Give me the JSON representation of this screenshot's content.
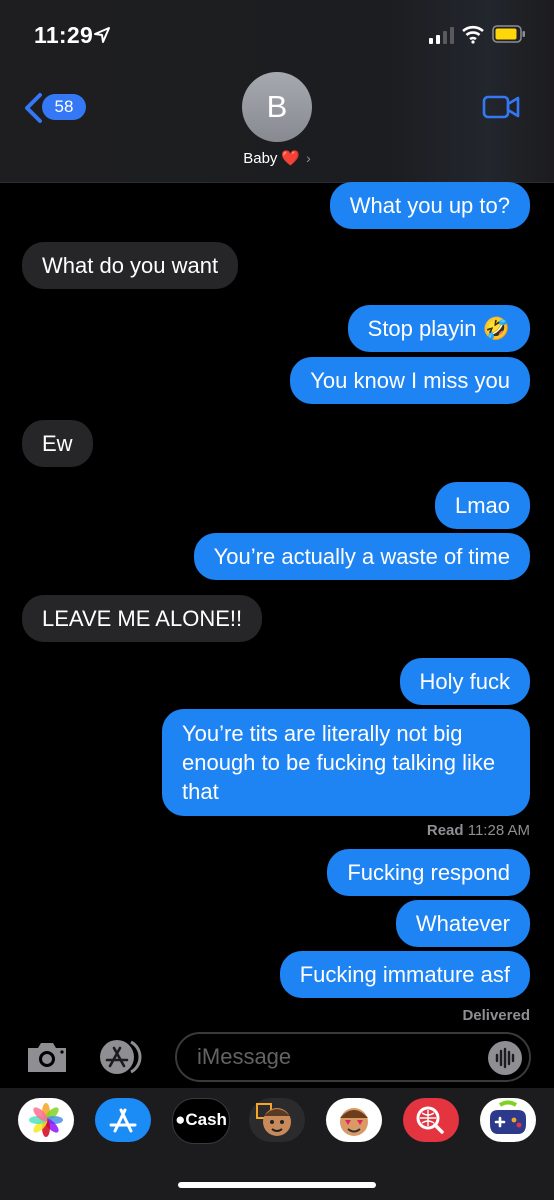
{
  "status_bar": {
    "time": "11:29"
  },
  "header": {
    "back_count": "58",
    "avatar_initial": "B",
    "contact_name": "Baby",
    "heart": "❤️"
  },
  "messages": [
    {
      "dir": "out",
      "text": "What you up to?"
    },
    {
      "dir": "in",
      "text": "What do you want"
    },
    {
      "dir": "out",
      "text": "Stop playin 🤣"
    },
    {
      "dir": "out",
      "text": "You know I miss you"
    },
    {
      "dir": "in",
      "text": "Ew"
    },
    {
      "dir": "out",
      "text": "Lmao"
    },
    {
      "dir": "out",
      "text": "You’re actually a waste of time"
    },
    {
      "dir": "in",
      "text": "LEAVE ME ALONE!!"
    },
    {
      "dir": "out",
      "text": "Holy fuck"
    },
    {
      "dir": "out",
      "text": "You’re tits are literally not big enough to be fucking talking like that"
    },
    {
      "dir": "out",
      "text": "Fucking respond"
    },
    {
      "dir": "out",
      "text": "Whatever"
    },
    {
      "dir": "out",
      "text": "Fucking immature asf"
    }
  ],
  "read_receipt": {
    "label": "Read",
    "time": "11:28 AM"
  },
  "delivered": "Delivered",
  "input": {
    "placeholder": "iMessage"
  },
  "app_drawer": {
    "apps": [
      "photos-icon",
      "appstore-icon",
      "apple-cash",
      "memoji-1",
      "memoji-2",
      "search-images-icon",
      "game-icon"
    ],
    "cash_label": "Cash"
  },
  "colors": {
    "outgoing": "#1f84f3",
    "incoming": "#262628",
    "accent": "#3478f6"
  }
}
